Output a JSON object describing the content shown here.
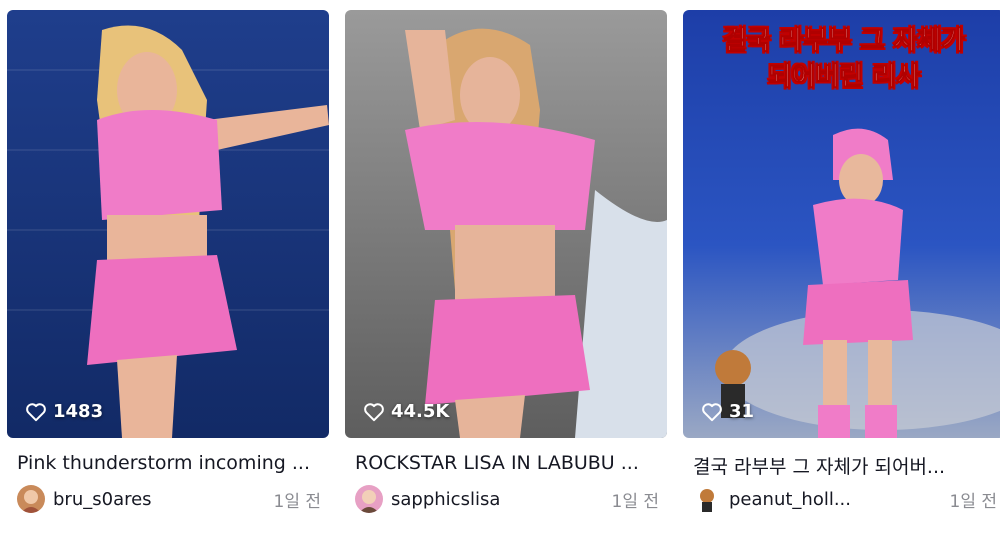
{
  "cards": [
    {
      "likes": "1483",
      "caption": "Pink thunderstorm incoming ...",
      "username": "bru_s0ares",
      "age": "1일 전"
    },
    {
      "likes": "44.5K",
      "caption": "ROCKSTAR LISA IN LABUBU ...",
      "username": "sapphicslisa",
      "age": "1일 전"
    },
    {
      "likes": "31",
      "caption": "결국 라부부 그 자체가 되어버...",
      "username": "peanut_holl...",
      "age": "1일 전",
      "overlay_line1": "결국 라부부 그 자체가",
      "overlay_line2": "되어버린 리사"
    }
  ],
  "colors": {
    "outfit_pink": "#f07cc8",
    "overlay_red": "#c20000",
    "muted": "#8a8b91"
  }
}
